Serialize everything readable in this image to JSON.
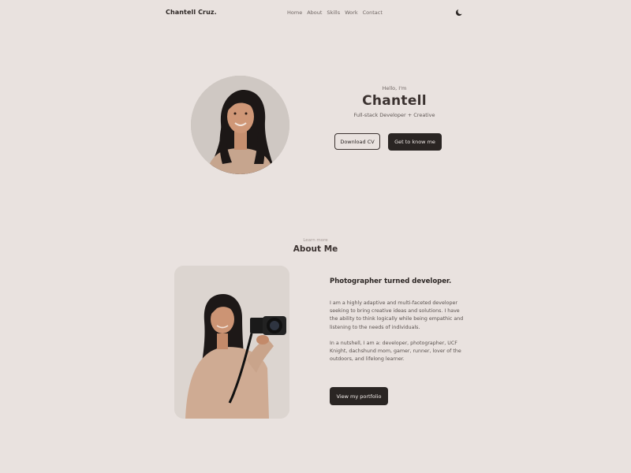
{
  "nav": {
    "brand": "Chantell Cruz.",
    "links": [
      "Home",
      "About",
      "Skills",
      "Work",
      "Contact"
    ],
    "theme_icon": "moon-icon"
  },
  "hero": {
    "greeting": "Hello, I'm",
    "name": "Chantell",
    "role": "Full-stack Developer + Creative",
    "download_cv": "Download CV",
    "get_to_know": "Get to know me"
  },
  "about": {
    "subtitle": "Learn more",
    "title": "About Me",
    "heading": "Photographer turned developer.",
    "paragraph1": "I am a highly adaptive and multi-faceted developer seeking to bring creative ideas and solutions. I have the ability to think logically while being empathic and listening to the needs of individuals.",
    "paragraph2": "In a nutshell, I am a: developer, photographer, UCF Knight, dachshund mom, gamer, runner, lover of the outdoors, and lifelong learner.",
    "portfolio_button": "View my portfolio"
  },
  "colors": {
    "background": "#e9e2df",
    "dark": "#2a2523",
    "text_muted": "#6f6663"
  }
}
